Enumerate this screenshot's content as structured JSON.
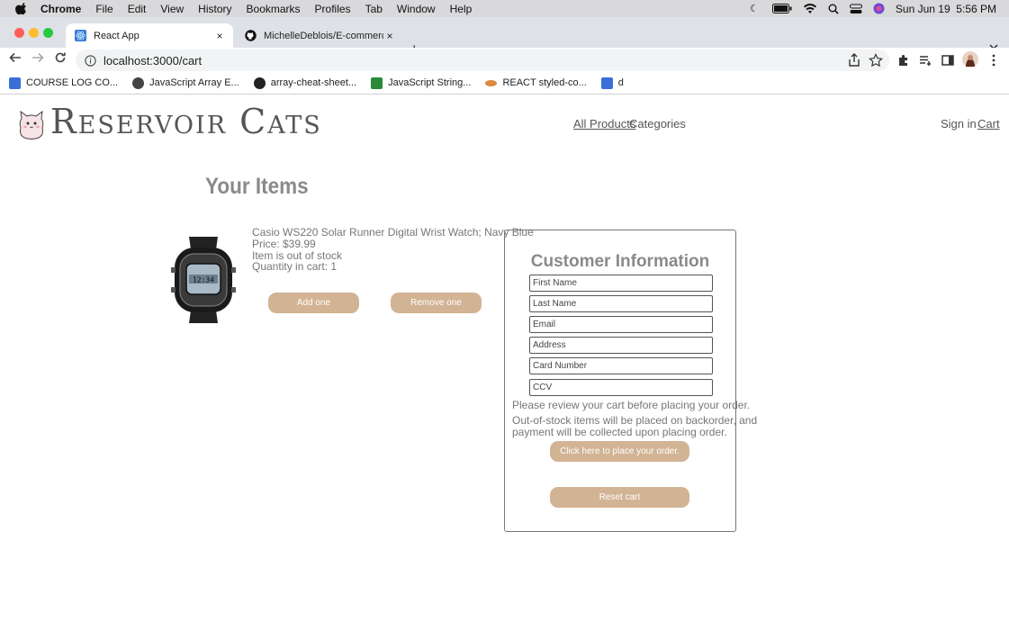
{
  "menubar": {
    "items": [
      "Chrome",
      "File",
      "Edit",
      "View",
      "History",
      "Bookmarks",
      "Profiles",
      "Tab",
      "Window",
      "Help"
    ],
    "clock": "Sun Jun 19  5:56 PM"
  },
  "tabs": [
    {
      "title": "React App",
      "close": "×"
    },
    {
      "title": "MichelleDeblois/E-commerce",
      "close": "×"
    }
  ],
  "new_tab": "+",
  "toolbar": {
    "url": "localhost:3000/cart"
  },
  "bookmarks": [
    {
      "label": "COURSE LOG CO...",
      "color": "#3b6fd8"
    },
    {
      "label": "JavaScript Array E...",
      "color": "#444444"
    },
    {
      "label": "array-cheat-sheet...",
      "color": "#222222"
    },
    {
      "label": "JavaScript String...",
      "color": "#2a8a3a"
    },
    {
      "label": "REACT styled-co...",
      "color": "#d98a3a"
    },
    {
      "label": "d",
      "color": "#3b6fd8"
    }
  ],
  "site": {
    "logo": "Reservoir Cats",
    "nav": {
      "all_products": "All Products",
      "categories": "Categories",
      "sign_in": "Sign in",
      "cart": "Cart"
    }
  },
  "cart": {
    "heading": "Your Items",
    "item": {
      "name": "Casio WS220 Solar Runner Digital Wrist Watch; Navy Blue",
      "price": "Price: $39.99",
      "stock": "Item is out of stock",
      "quantity": "Quantity in cart: 1"
    },
    "add_label": "Add one",
    "remove_label": "Remove one"
  },
  "customer": {
    "title": "Customer Information",
    "fields": [
      "First Name",
      "Last Name",
      "Email",
      "Address",
      "Card Number",
      "CCV"
    ],
    "review_note": "Please review your cart before placing your order.",
    "backorder_note_1": "Out-of-stock items will be placed on backorder, and",
    "backorder_note_2": "payment will be collected upon placing order.",
    "place_order_label": "Click here to place your order.",
    "reset_label": "Reset cart"
  },
  "colors": {
    "button": "#d2b394",
    "heading": "#8a8a8a"
  }
}
